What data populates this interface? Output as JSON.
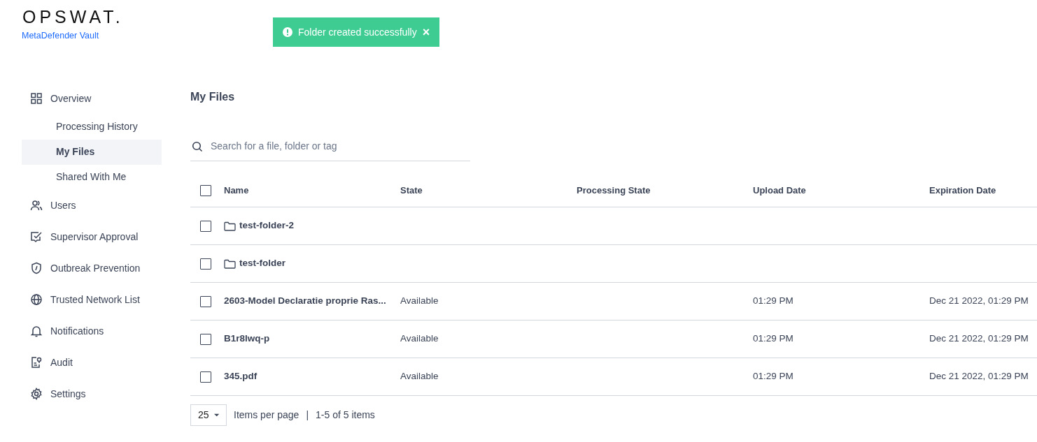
{
  "brand": {
    "logo": "OPSWAT.",
    "product": "MetaDefender Vault"
  },
  "toast": {
    "message": "Folder created successfully",
    "close": "×"
  },
  "sidebar": {
    "items": [
      {
        "label": "Overview",
        "selected": false,
        "children": [
          {
            "label": "Processing History",
            "selected": false
          },
          {
            "label": "My Files",
            "selected": true
          },
          {
            "label": "Shared With Me",
            "selected": false
          }
        ]
      },
      {
        "label": "Users",
        "selected": false
      },
      {
        "label": "Supervisor Approval",
        "selected": false
      },
      {
        "label": "Outbreak Prevention",
        "selected": false
      },
      {
        "label": "Trusted Network List",
        "selected": false
      },
      {
        "label": "Notifications",
        "selected": false
      },
      {
        "label": "Audit",
        "selected": false
      },
      {
        "label": "Settings",
        "selected": false
      }
    ]
  },
  "page": {
    "title": "My Files"
  },
  "search": {
    "placeholder": "Search for a file, folder or tag"
  },
  "table": {
    "select_all_checked": false,
    "columns": [
      "Name",
      "State",
      "Processing State",
      "Upload Date",
      "Expiration Date"
    ],
    "rows": [
      {
        "kind": "folder",
        "checked": false,
        "name": "test-folder-2"
      },
      {
        "kind": "folder",
        "checked": false,
        "name": "test-folder"
      },
      {
        "kind": "file",
        "checked": false,
        "name": "2603-Model Declaratie proprie Ras...",
        "state": "Available",
        "upload_date": "01:29 PM",
        "expiration_date": "Dec 21 2022, 01:29 PM"
      },
      {
        "kind": "file",
        "checked": false,
        "name": "B1r8lwq-p",
        "state": "Available",
        "upload_date": "01:29 PM",
        "expiration_date": "Dec 21 2022, 01:29 PM"
      },
      {
        "kind": "file",
        "checked": false,
        "name": "345.pdf",
        "state": "Available",
        "upload_date": "01:29 PM",
        "expiration_date": "Dec 21 2022, 01:29 PM"
      }
    ]
  },
  "pagination": {
    "page_size": "25",
    "per_page_label": "Items per page",
    "separator": "|",
    "range": "1-5 of 5 items"
  }
}
